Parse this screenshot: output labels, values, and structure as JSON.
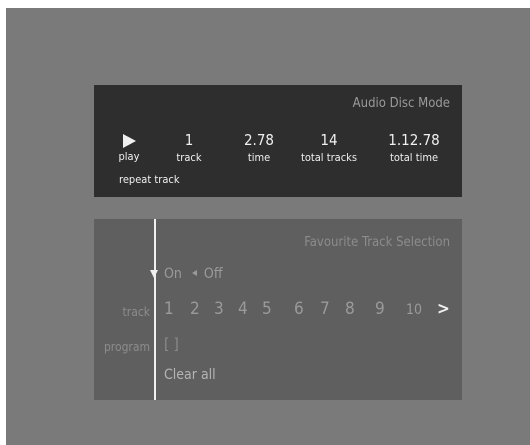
{
  "status_panel": {
    "title": "Audio Disc Mode",
    "play_icon": "play-icon",
    "play_label": "play",
    "track_value": "1",
    "track_label": "track",
    "time_value": "2.78",
    "time_label": "time",
    "total_tracks_value": "14",
    "total_tracks_label": "total tracks",
    "total_time_value": "1.12.78",
    "total_time_label": "total time",
    "repeat_label": "repeat track"
  },
  "favourite_panel": {
    "title": "Favourite Track Selection",
    "on_label": "On",
    "off_label": "Off",
    "track_row_label": "track",
    "program_row_label": "program",
    "tracks": [
      "1",
      "2",
      "3",
      "4",
      "5",
      "6",
      "7",
      "8",
      "9",
      "10"
    ],
    "next_label": ">",
    "program_slot": "[ ]",
    "clear_all_label": "Clear all"
  },
  "colors": {
    "screen_bg": "#7a7a7a",
    "status_bg": "#2e2e2e",
    "favourite_bg": "#5f5f5f",
    "highlight": "#f0f0f0",
    "dim_text": "#9a9a9a"
  }
}
